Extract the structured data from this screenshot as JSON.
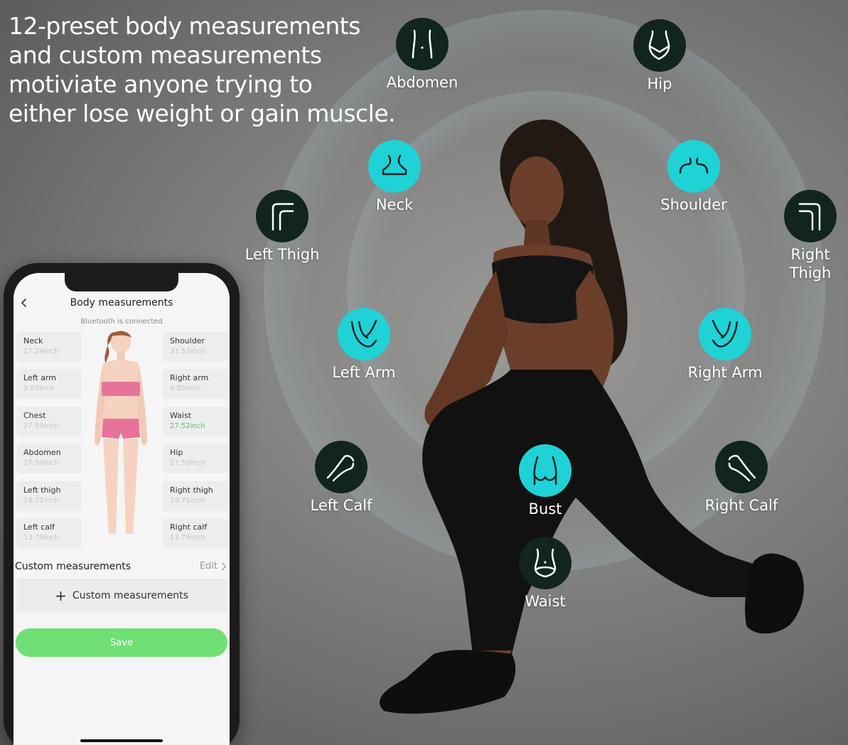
{
  "headline": {
    "line1": "12-preset body measurements",
    "line2": "and custom measurements",
    "line3": "motiviate anyone trying to",
    "line4": "either lose weight or gain muscle."
  },
  "badges": {
    "abdomen": {
      "label": "Abdomen",
      "icon": "abdomen-icon",
      "style": "dark"
    },
    "hip": {
      "label": "Hip",
      "icon": "hip-icon",
      "style": "dark"
    },
    "neck": {
      "label": "Neck",
      "icon": "neck-icon",
      "style": "cyan"
    },
    "shoulder": {
      "label": "Shoulder",
      "icon": "shoulder-icon",
      "style": "cyan"
    },
    "left_thigh": {
      "label": "Left Thigh",
      "icon": "left-thigh-icon",
      "style": "dark"
    },
    "right_thigh": {
      "label_line1": "Right",
      "label_line2": "Thigh",
      "icon": "right-thigh-icon",
      "style": "dark"
    },
    "left_arm": {
      "label": "Left Arm",
      "icon": "left-arm-icon",
      "style": "cyan"
    },
    "right_arm": {
      "label": "Right Arm",
      "icon": "right-arm-icon",
      "style": "cyan"
    },
    "left_calf": {
      "label": "Left Calf",
      "icon": "left-calf-icon",
      "style": "dark"
    },
    "bust": {
      "label": "Bust",
      "icon": "bust-icon",
      "style": "cyan"
    },
    "right_calf": {
      "label": "Right Calf",
      "icon": "right-calf-icon",
      "style": "dark"
    },
    "waist": {
      "label": "Waist",
      "icon": "waist-icon",
      "style": "dark"
    }
  },
  "phone": {
    "title": "Body measurements",
    "status": "Bluetooth is connected",
    "left_column": [
      {
        "name": "Neck",
        "value": "27.24inch"
      },
      {
        "name": "Left arm",
        "value": "9.85inch"
      },
      {
        "name": "Chest",
        "value": "27.59inch"
      },
      {
        "name": "Abdomen",
        "value": "27.59inch"
      },
      {
        "name": "Left thigh",
        "value": "19.71inch"
      },
      {
        "name": "Left calf",
        "value": "13.79inch"
      }
    ],
    "right_column": [
      {
        "name": "Shoulder",
        "value": "31.53inch"
      },
      {
        "name": "Right arm",
        "value": "9.85inch"
      },
      {
        "name": "Waist",
        "value": "27.52inch"
      },
      {
        "name": "Hip",
        "value": "27.59inch"
      },
      {
        "name": "Right thigh",
        "value": "19.71inch"
      },
      {
        "name": "Right calf",
        "value": "13.79inch"
      }
    ],
    "custom_section_title": "Custom measurements",
    "edit_label": "Edit",
    "custom_add_label": "Custom measurements",
    "save_label": "Save"
  },
  "colors": {
    "accent_cyan": "#1fd2d6",
    "badge_dark": "#112420",
    "save_green": "#6fe073",
    "active_value_green": "#47c95c"
  }
}
